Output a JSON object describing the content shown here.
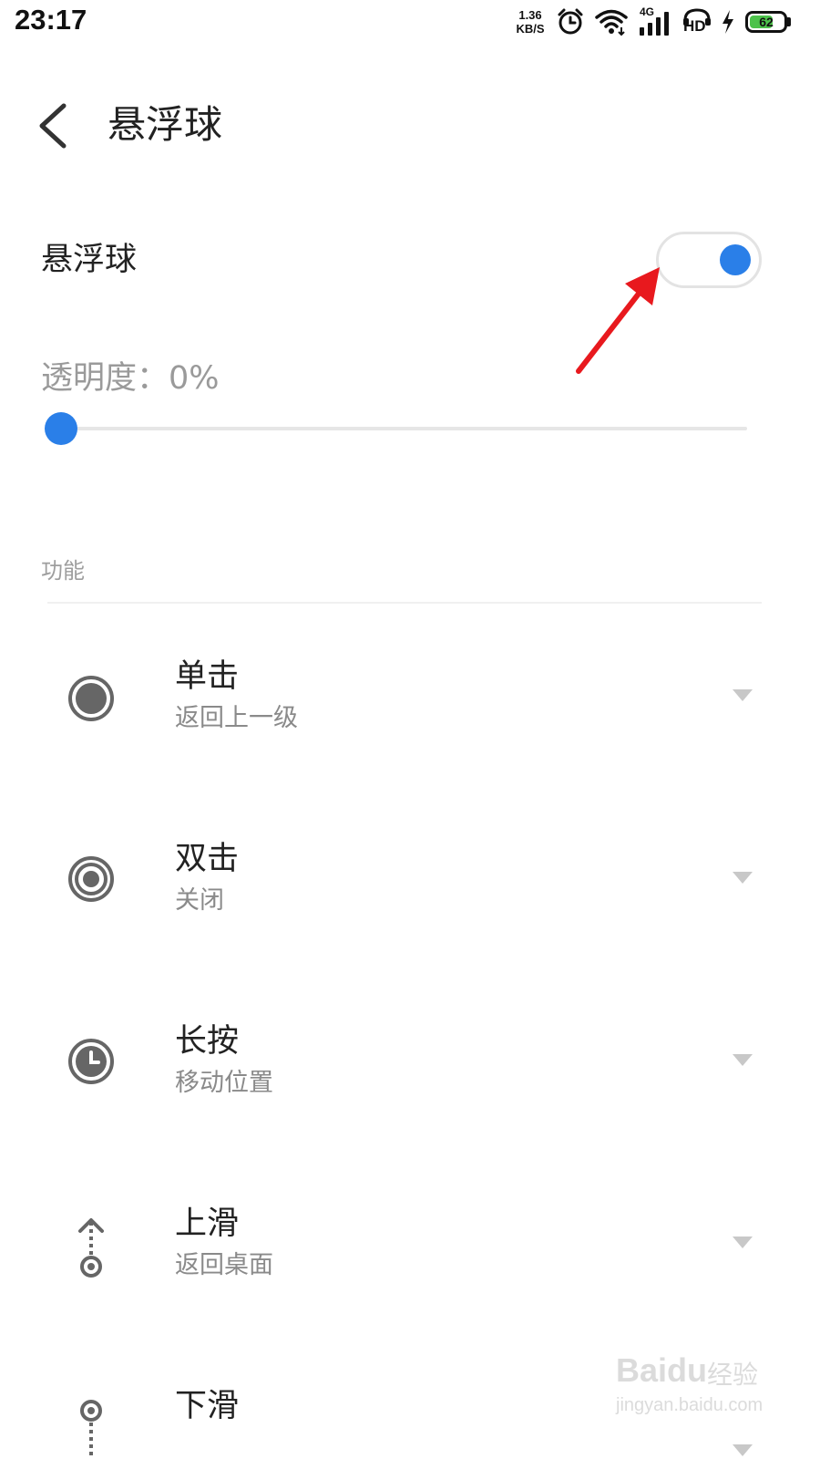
{
  "status_bar": {
    "time": "23:17",
    "net_speed_value": "1.36",
    "net_speed_unit": "KB/S",
    "network_type": "4G",
    "hd_label": "HD",
    "battery_level": "62",
    "icons": [
      "alarm-icon",
      "wifi-icon",
      "signal-icon",
      "hd-call-icon",
      "charging-icon",
      "battery-icon"
    ]
  },
  "header": {
    "title": "悬浮球",
    "back_icon": "chevron-left-icon"
  },
  "floating_ball_toggle": {
    "label": "悬浮球",
    "state": "on"
  },
  "opacity": {
    "label": "透明度：0%",
    "value": 0
  },
  "section": {
    "header": "功能"
  },
  "functions": [
    {
      "title": "单击",
      "subtitle": "返回上一级",
      "icon": "single-tap-icon"
    },
    {
      "title": "双击",
      "subtitle": "关闭",
      "icon": "double-tap-icon"
    },
    {
      "title": "长按",
      "subtitle": "移动位置",
      "icon": "long-press-icon"
    },
    {
      "title": "上滑",
      "subtitle": "返回桌面",
      "icon": "swipe-up-icon"
    },
    {
      "title": "下滑",
      "subtitle": "",
      "icon": "swipe-down-icon"
    }
  ],
  "watermark": {
    "brand": "Baidu",
    "sub": "经验",
    "url": "jingyan.baidu.com"
  },
  "colors": {
    "accent": "#2a7fe8",
    "annotation_arrow": "#e8191e",
    "battery_fill": "#4cc24a"
  }
}
